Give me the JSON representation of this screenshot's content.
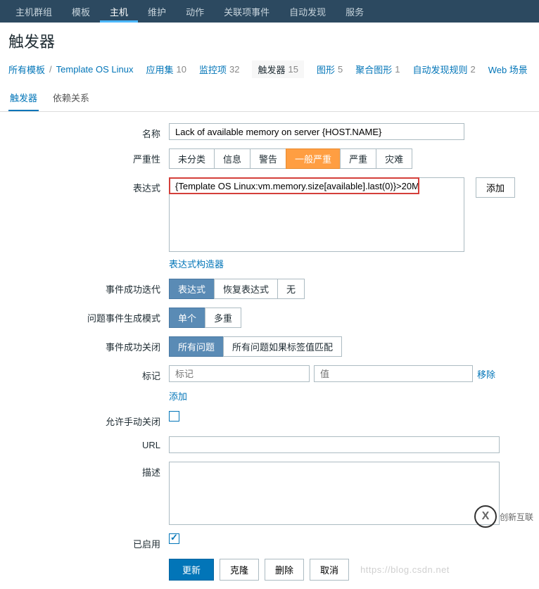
{
  "topNav": {
    "items": [
      "主机群组",
      "模板",
      "主机",
      "维护",
      "动作",
      "关联项事件",
      "自动发现",
      "服务"
    ],
    "activeIndex": 2
  },
  "pageTitle": "触发器",
  "breadcrumb": {
    "allTemplates": "所有模板",
    "templateName": "Template OS Linux",
    "items": [
      {
        "label": "应用集",
        "count": "10"
      },
      {
        "label": "监控项",
        "count": "32"
      },
      {
        "label": "触发器",
        "count": "15",
        "active": true
      },
      {
        "label": "图形",
        "count": "5"
      },
      {
        "label": "聚合图形",
        "count": "1"
      },
      {
        "label": "自动发现规则",
        "count": "2"
      },
      {
        "label": "Web 场景",
        "count": ""
      }
    ]
  },
  "tabs": {
    "trigger": "触发器",
    "dependency": "依赖关系"
  },
  "form": {
    "nameLabel": "名称",
    "nameValue": "Lack of available memory on server {HOST.NAME}",
    "severityLabel": "严重性",
    "severities": [
      "未分类",
      "信息",
      "警告",
      "一般严重",
      "严重",
      "灾难"
    ],
    "severityActiveIndex": 3,
    "exprLabel": "表达式",
    "exprValue": "{Template OS Linux:vm.memory.size[available].last(0)}>20M",
    "addBtn": "添加",
    "exprBuilder": "表达式构造器",
    "okEventLabel": "事件成功迭代",
    "okEventOptions": [
      "表达式",
      "恢复表达式",
      "无"
    ],
    "okEventActiveIndex": 0,
    "problemModeLabel": "问题事件生成模式",
    "problemModeOptions": [
      "单个",
      "多重"
    ],
    "problemModeActiveIndex": 0,
    "okCloseLabel": "事件成功关闭",
    "okCloseOptions": [
      "所有问题",
      "所有问题如果标签值匹配"
    ],
    "okCloseActiveIndex": 0,
    "tagLabel": "标记",
    "tagPlaceholder": "标记",
    "valuePlaceholder": "值",
    "removeLink": "移除",
    "addLink": "添加",
    "manualCloseLabel": "允许手动关闭",
    "urlLabel": "URL",
    "descLabel": "描述",
    "enabledLabel": "已启用"
  },
  "actions": {
    "update": "更新",
    "clone": "克隆",
    "delete": "删除",
    "cancel": "取消"
  },
  "watermark": "https://blog.csdn.net",
  "footerLogo": "创新互联"
}
